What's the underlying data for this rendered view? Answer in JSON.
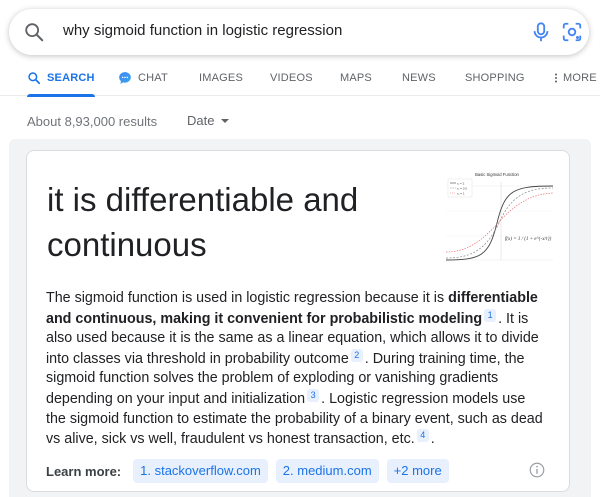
{
  "search": {
    "query": "why sigmoid function in logistic regression"
  },
  "tabs": [
    {
      "label": "SEARCH"
    },
    {
      "label": "CHAT"
    },
    {
      "label": "IMAGES"
    },
    {
      "label": "VIDEOS"
    },
    {
      "label": "MAPS"
    },
    {
      "label": "NEWS"
    },
    {
      "label": "SHOPPING"
    },
    {
      "label": "MORE"
    }
  ],
  "results": {
    "stats": "About 8,93,000 results",
    "date_filter": "Date"
  },
  "featured": {
    "answer": "it is differentiable and continuous",
    "snippet": {
      "p1": "The sigmoid function is used in logistic regression because it is ",
      "b1": "differentiable and continuous, making it convenient for probabilistic modeling",
      "c1": "1",
      "p2": ". It is also used because it is the same as a linear equation, which allows it to divide into classes via threshold in probability outcome",
      "c2": "2",
      "p3": ". During training time, the sigmoid function solves the problem of exploding or vanishing gradients depending on your input and initialization",
      "c3": "3",
      "p4": ". Logistic regression models use the sigmoid function to estimate the probability of a binary event, such as dead vs alive, sick vs well, fraudulent vs honest transaction, etc.",
      "c4": "4",
      "p5": "."
    },
    "thumbnail": {
      "title": "Basic Sigmoid Function",
      "legend": [
        "τ₁ = 2",
        "τ₂ = 0.5",
        "τ₃ = 1"
      ],
      "formula": "f(x) = 1 / (1 + e^{-x/τ})"
    },
    "learn_more": {
      "label": "Learn more:",
      "links": [
        "1. stackoverflow.com",
        "2. medium.com",
        "+2 more"
      ]
    }
  },
  "colors": {
    "accent": "#1a73e8",
    "chip_bg": "#e8f0fe",
    "panel_bg": "#f1f3f4"
  },
  "icons": [
    "search-icon",
    "mic-icon",
    "lens-icon",
    "chat-icon",
    "more-vert-icon",
    "info-icon"
  ]
}
